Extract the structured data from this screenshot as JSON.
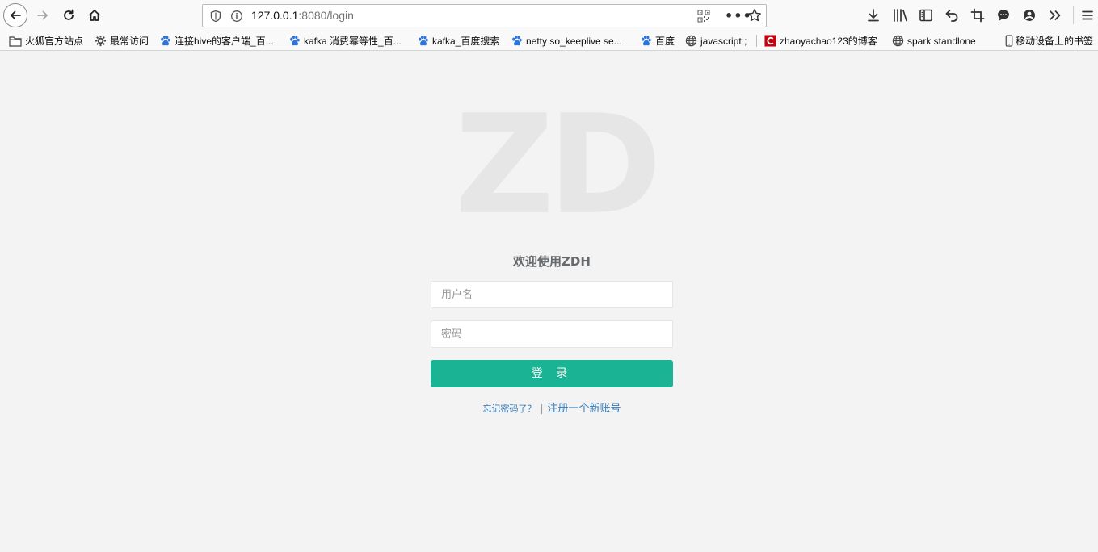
{
  "browser": {
    "url_host": "127.0.0.1",
    "url_rest": ":8080/login",
    "bookmarks": [
      {
        "label": "火狐官方站点",
        "icon": "folder-icon"
      },
      {
        "label": "最常访问",
        "icon": "gear-icon"
      },
      {
        "label": "连接hive的客户端_百...",
        "icon": "baidu-paw-icon"
      },
      {
        "label": "kafka 消费幂等性_百...",
        "icon": "baidu-paw-icon"
      },
      {
        "label": "kafka_百度搜索",
        "icon": "baidu-paw-icon"
      },
      {
        "label": "netty so_keeplive se...",
        "icon": "baidu-paw-icon"
      },
      {
        "label": "百度",
        "icon": "baidu-paw-icon"
      },
      {
        "label": "javascript:;",
        "icon": "globe-icon"
      },
      {
        "label": "zhaoyachao123的博客",
        "icon": "csdn-icon"
      },
      {
        "label": "spark standlone",
        "icon": "globe-icon"
      },
      {
        "label": "移动设备上的书签",
        "icon": "mobile-icon"
      }
    ]
  },
  "page": {
    "logo_text": "ZD",
    "welcome": "欢迎使用ZDH",
    "username_placeholder": "用户名",
    "password_placeholder": "密码",
    "login_button": "登 录",
    "forgot_link": "忘记密码了？",
    "separator": "|",
    "register_link": "注册一个新账号"
  },
  "colors": {
    "accent": "#1ab394",
    "link": "#337ab7",
    "page_bg": "#f3f3f3",
    "logo": "#e6e6e6"
  }
}
